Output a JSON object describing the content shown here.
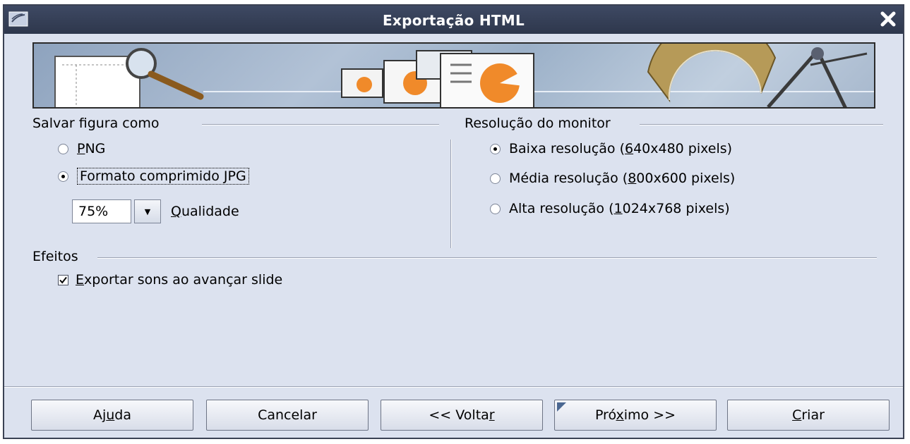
{
  "window": {
    "title": "Exportação HTML"
  },
  "save_image": {
    "group_title": "Salvar figura como",
    "options": [
      {
        "label_pre": "",
        "mnemonic": "P",
        "label_post": "NG",
        "selected": false
      },
      {
        "label_pre": "Formato comprimido ",
        "mnemonic": "J",
        "label_post": "PG",
        "selected": true
      }
    ],
    "quality_value": "75%",
    "quality_label_pre": "",
    "quality_mnemonic": "Q",
    "quality_label_post": "ualidade"
  },
  "monitor_resolution": {
    "group_title": "Resolução do monitor",
    "options": [
      {
        "label_pre": "Baixa resolução (",
        "mnemonic": "6",
        "label_post": "40x480 pixels)",
        "selected": true
      },
      {
        "label_pre": "Média resolução (",
        "mnemonic": "8",
        "label_post": "00x600 pixels)",
        "selected": false
      },
      {
        "label_pre": "Alta resolução (",
        "mnemonic": "1",
        "label_post": "024x768 pixels)",
        "selected": false
      }
    ]
  },
  "effects": {
    "group_title": "Efeitos",
    "checkbox_pre": "",
    "checkbox_mnemonic": "E",
    "checkbox_post": "xportar sons ao avançar slide",
    "checked": true
  },
  "buttons": {
    "help": {
      "pre": "Aj",
      "mnemonic": "u",
      "post": "da"
    },
    "cancel": {
      "pre": "Cancelar",
      "mnemonic": "",
      "post": ""
    },
    "back": {
      "pre": "<< Volta",
      "mnemonic": "r",
      "post": ""
    },
    "next": {
      "pre": "Pró",
      "mnemonic": "x",
      "post": "imo >>"
    },
    "create": {
      "pre": "",
      "mnemonic": "C",
      "post": "riar"
    }
  },
  "icons": {
    "window_menu": "window-menu-icon",
    "close": "close-icon",
    "dropdown": "chevron-down-icon",
    "check": "checkmark-icon"
  },
  "colors": {
    "titlebar": "#333d55",
    "dialog_bg": "#dce2ef",
    "accent": "#4a6791"
  }
}
